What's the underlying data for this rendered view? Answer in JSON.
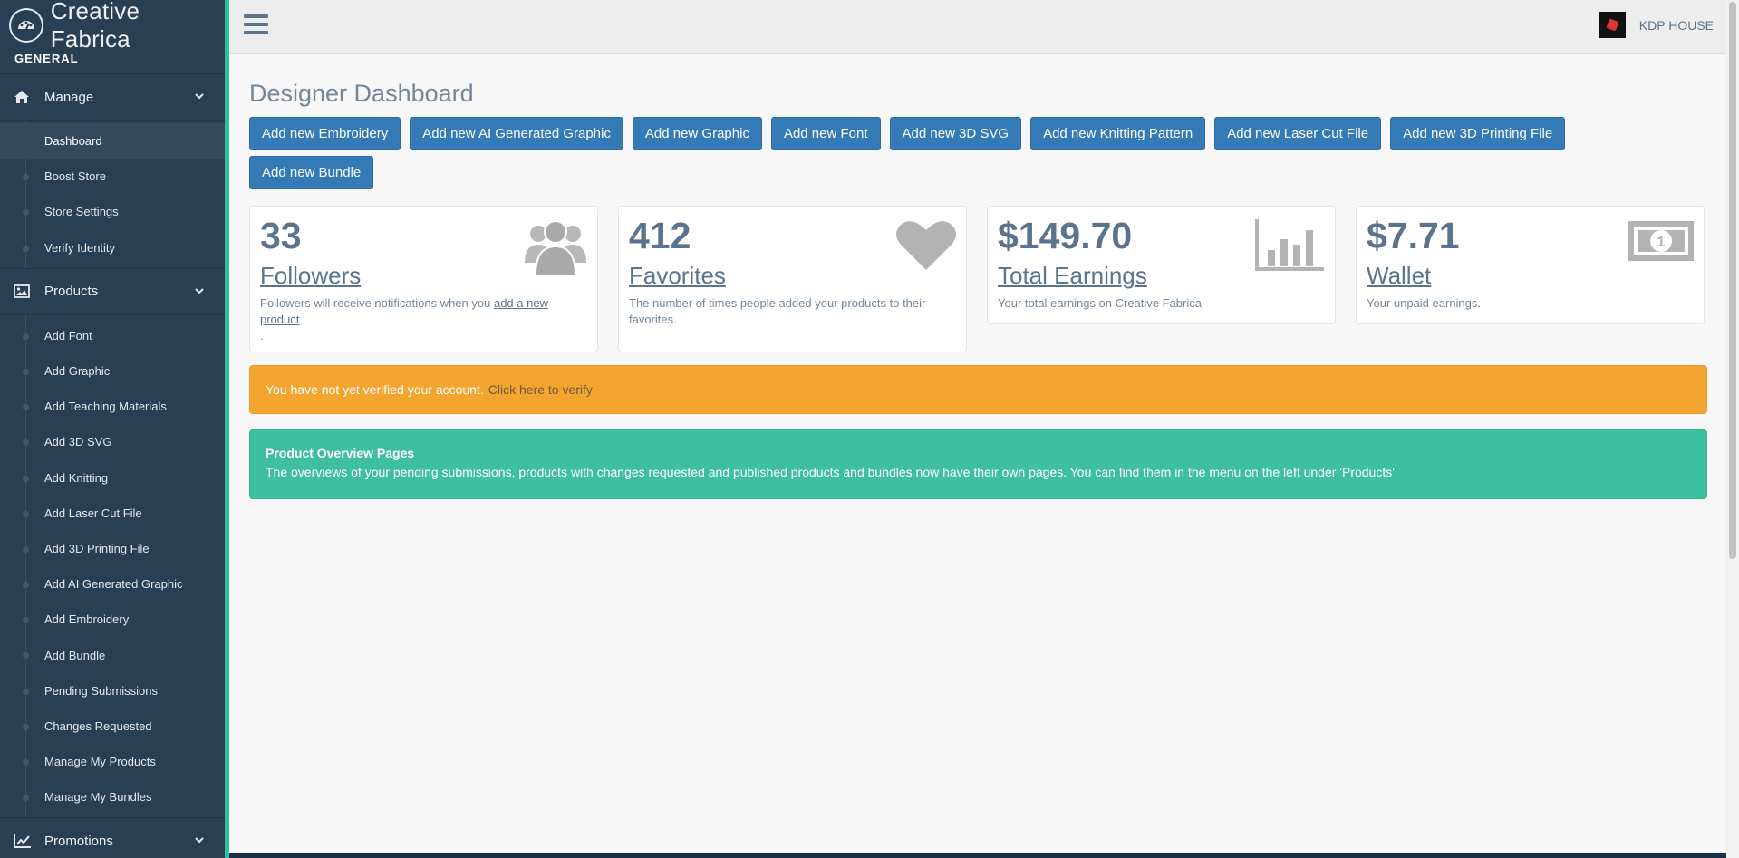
{
  "brand": {
    "title": "Creative Fabrica"
  },
  "sidebar": {
    "section": "GENERAL",
    "groups": [
      {
        "label": "Manage",
        "icon": "home-icon",
        "items": [
          "Dashboard",
          "Boost Store",
          "Store Settings",
          "Verify Identity"
        ]
      },
      {
        "label": "Products",
        "icon": "image-icon",
        "items": [
          "Add Font",
          "Add Graphic",
          "Add Teaching Materials",
          "Add 3D SVG",
          "Add Knitting",
          "Add Laser Cut File",
          "Add 3D Printing File",
          "Add AI Generated Graphic",
          "Add Embroidery",
          "Add Bundle",
          "Pending Submissions",
          "Changes Requested",
          "Manage My Products",
          "Manage My Bundles"
        ]
      },
      {
        "label": "Promotions",
        "icon": "line-chart-icon",
        "items": []
      }
    ],
    "active_item": "Dashboard"
  },
  "topbar": {
    "user_name": "KDP HOUSE"
  },
  "main": {
    "title": "Designer Dashboard",
    "buttons": [
      "Add new Embroidery",
      "Add new AI Generated Graphic",
      "Add new Graphic",
      "Add new Font",
      "Add new 3D SVG",
      "Add new Knitting Pattern",
      "Add new Laser Cut File",
      "Add new 3D Printing File",
      "Add new Bundle"
    ],
    "stats": {
      "followers": {
        "count": "33",
        "label": "Followers",
        "desc_pre": "Followers will receive notifications when you",
        "desc_link": "add a new product",
        "desc_post": ".",
        "icon": "users-icon"
      },
      "favorites": {
        "count": "412",
        "label": "Favorites",
        "desc": "The number of times people added your products to their favorites.",
        "icon": "heart-icon"
      },
      "earnings": {
        "count": "$149.70",
        "label": "Total Earnings",
        "desc": "Your total earnings on Creative Fabrica",
        "icon": "bar-chart-icon"
      },
      "wallet": {
        "count": "$7.71",
        "label": "Wallet",
        "desc": "Your unpaid earnings.",
        "icon": "money-icon"
      }
    },
    "warning": {
      "text": "You have not yet verified your account.",
      "link": "Click here to verify"
    },
    "info": {
      "heading": "Product Overview Pages",
      "text": "The overviews of your pending submissions, products with changes requested and published products and bundles now have their own pages. You can find them in the menu on the left under 'Products'"
    }
  },
  "colors": {
    "sidebar_bg": "#2a3f54",
    "accent_green": "#2fbf9a",
    "button_blue": "#337ab7",
    "warning": "#f3a530",
    "info": "#3ebfa0"
  }
}
